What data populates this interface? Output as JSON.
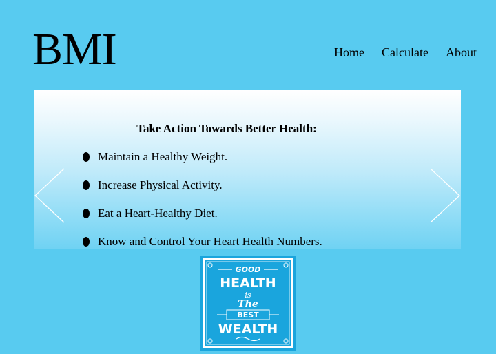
{
  "header": {
    "logo": "BMI",
    "nav": [
      {
        "label": "Home",
        "active": true
      },
      {
        "label": "Calculate",
        "active": false
      },
      {
        "label": "About",
        "active": false
      }
    ]
  },
  "slider": {
    "heading": "Take Action Towards Better Health:",
    "tips": [
      "Maintain a Healthy Weight.",
      "Increase Physical Activity.",
      "Eat a Heart-Healthy Diet.",
      "Know and Control Your Heart Health Numbers."
    ],
    "prev_icon": "chevron-left-icon",
    "next_icon": "chevron-right-icon"
  },
  "poster": {
    "line1": "GOOD",
    "line2": "HEALTH",
    "line3": "is",
    "line4": "The",
    "line5": "BEST",
    "line6": "WEALTH"
  },
  "colors": {
    "page_background": "#58cbf0",
    "poster_background": "#1aa5dd"
  }
}
